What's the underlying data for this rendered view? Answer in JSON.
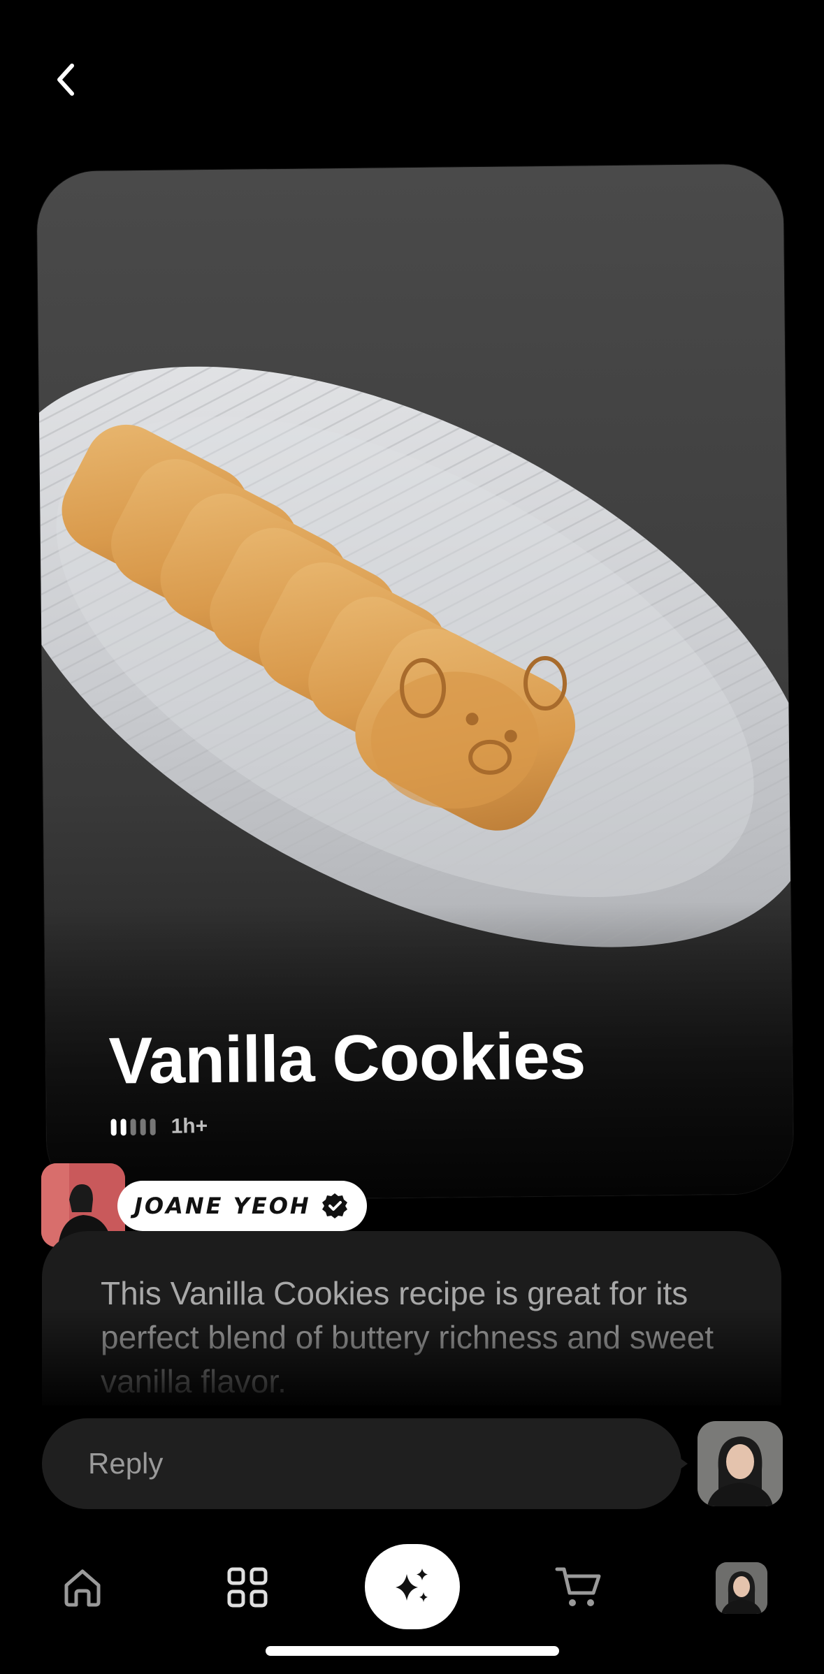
{
  "navigation": {
    "back_icon": "chevron-left-icon"
  },
  "recipe": {
    "title": "Vanilla Cookies",
    "difficulty_level": 2,
    "difficulty_max": 5,
    "time": "1h+",
    "photo_subject": "bear-shaped vanilla cookies on a white ribbed plate"
  },
  "author": {
    "name": "JOANE YEOH",
    "verified_icon": "verified-badge-icon"
  },
  "description": {
    "text": "This Vanilla Cookies recipe is great for its perfect blend of buttery richness and sweet vanilla flavor."
  },
  "reply": {
    "placeholder": "Reply"
  },
  "bottom_nav": {
    "items": [
      "home-icon",
      "grid-icon",
      "sparkles-icon",
      "cart-icon",
      "profile-avatar"
    ]
  },
  "colors": {
    "background": "#000000",
    "card_surface": "#1c1c1c",
    "input_surface": "#1f1f1f",
    "accent": "#ffffff",
    "muted_text": "#a8a8a8"
  }
}
